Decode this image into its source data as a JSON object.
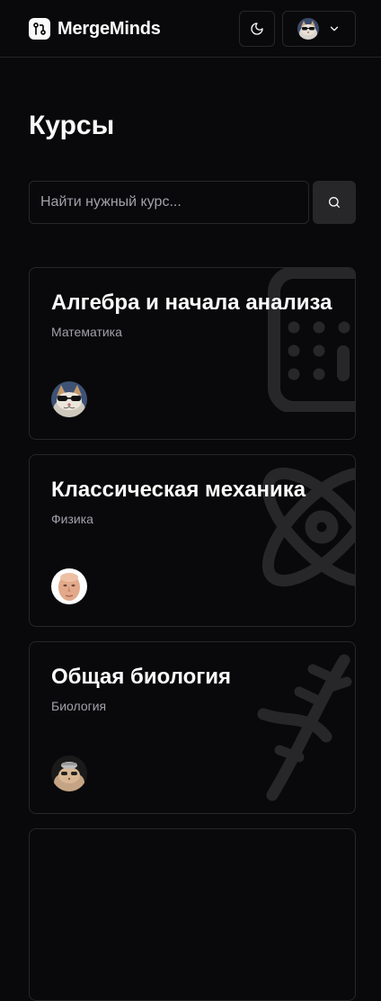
{
  "app": {
    "name": "MergeMinds"
  },
  "header": {
    "theme_toggle_icon": "moon-icon",
    "user_menu_icon": "chevron-down-icon"
  },
  "page": {
    "title": "Курсы"
  },
  "search": {
    "placeholder": "Найти нужный курс...",
    "value": "",
    "button_icon": "search-icon"
  },
  "courses": [
    {
      "title": "Алгебра и начала анализа",
      "subject": "Математика",
      "icon": "calculator-icon"
    },
    {
      "title": "Классическая механика",
      "subject": "Физика",
      "icon": "atom-icon"
    },
    {
      "title": "Общая биология",
      "subject": "Биология",
      "icon": "dna-icon"
    }
  ],
  "colors": {
    "background": "#09090b",
    "border": "#27272a",
    "text": "#fafafa",
    "muted_text": "#a1a1aa",
    "search_button_bg": "#27272a",
    "watermark_icon": "#27272a"
  }
}
